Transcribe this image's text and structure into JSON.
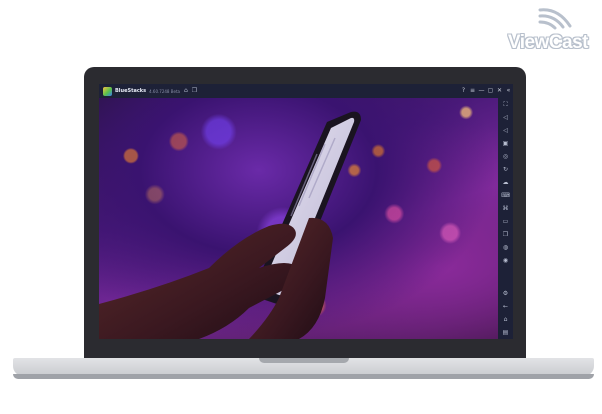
{
  "brand": {
    "logo_text": "ViewCast"
  },
  "emulator": {
    "app_name": "BlueStacks",
    "version": "4.60.7248 Beta",
    "titlebar_left_icons": [
      "home-icon",
      "multi-instance-icon"
    ],
    "titlebar_right_icons": [
      {
        "name": "help-icon",
        "glyph": "?"
      },
      {
        "name": "menu-icon",
        "glyph": "≡"
      },
      {
        "name": "minimize-icon",
        "glyph": "—"
      },
      {
        "name": "maximize-icon",
        "glyph": "▢"
      },
      {
        "name": "close-icon",
        "glyph": "✕"
      },
      {
        "name": "collapse-sidebar-icon",
        "glyph": "«"
      }
    ],
    "sidebar_icons": [
      {
        "name": "fullscreen-icon",
        "glyph": "⛶"
      },
      {
        "name": "volume-up-icon",
        "glyph": "◁"
      },
      {
        "name": "volume-down-icon",
        "glyph": "◁"
      },
      {
        "name": "screen-recorder-icon",
        "glyph": "▣"
      },
      {
        "name": "screenshot-icon",
        "glyph": "◎"
      },
      {
        "name": "rotate-icon",
        "glyph": "↻"
      },
      {
        "name": "shake-icon",
        "glyph": "☁"
      },
      {
        "name": "keyboard-controls-icon",
        "glyph": "⌨"
      },
      {
        "name": "macro-icon",
        "glyph": "⌘"
      },
      {
        "name": "folder-icon",
        "glyph": "▭"
      },
      {
        "name": "copy-icon",
        "glyph": "❐"
      },
      {
        "name": "eco-mode-icon",
        "glyph": "◍"
      },
      {
        "name": "location-icon",
        "glyph": "◉"
      },
      {
        "name": "settings-icon",
        "glyph": "⚙"
      },
      {
        "name": "back-icon",
        "glyph": "←"
      },
      {
        "name": "home-nav-icon",
        "glyph": "⌂"
      },
      {
        "name": "recent-apps-icon",
        "glyph": "▤"
      }
    ]
  },
  "colors": {
    "laptop_bezel": "#2b2b30",
    "emulator_chrome": "#1d2137",
    "logo_outline": "#b8c0cc"
  }
}
